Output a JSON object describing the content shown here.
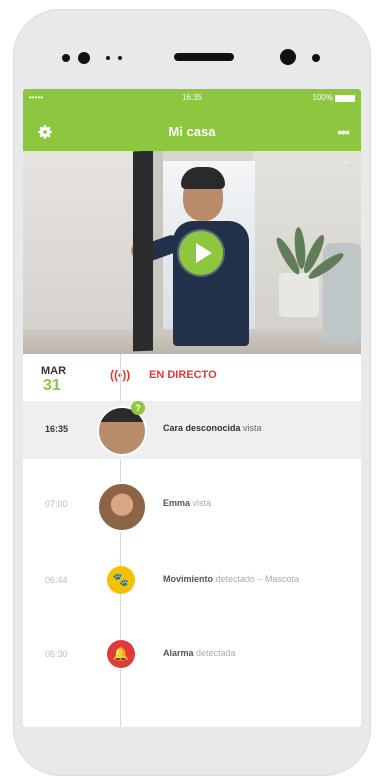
{
  "status_bar": {
    "carrier": "•••••",
    "time": "16:35",
    "battery": "100%"
  },
  "header": {
    "title": "Mi casa",
    "menu_label": "•••"
  },
  "video": {
    "playing": false
  },
  "timeline": {
    "date_month": "MAR",
    "date_day": "31",
    "live_icon": "((•))",
    "live_label": "EN DIRECTO",
    "events": [
      {
        "time": "16:35",
        "bold": "Cara desconocida",
        "rest": " vista",
        "badge": "?",
        "icon": "unknown-person-avatar"
      },
      {
        "time": "07:00",
        "bold": "Emma",
        "rest": " vista",
        "icon": "emma-avatar"
      },
      {
        "time": "06:44",
        "bold": "Movimiento",
        "rest": " detectado – Mascota",
        "icon": "paw-icon",
        "icon_glyph": "🐾"
      },
      {
        "time": "06:30",
        "bold": "Alarma",
        "rest": " detectada",
        "icon": "alarm-icon",
        "icon_glyph": "🔔"
      }
    ]
  },
  "colors": {
    "accent": "#8dc63f",
    "alert": "#e03a3a",
    "pet": "#f2c200"
  }
}
